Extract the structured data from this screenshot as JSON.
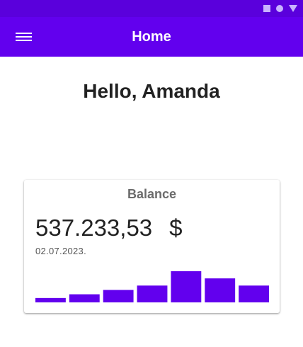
{
  "appbar": {
    "title": "Home",
    "background": "#6200ee",
    "statusbar_background": "#5a00dc"
  },
  "status_icons": [
    "square-icon",
    "circle-icon",
    "triangle-icon"
  ],
  "menu_icon": "hamburger-menu-icon",
  "greeting": "Hello, Amanda",
  "balance_card": {
    "title": "Balance",
    "amount": "537.233,53",
    "currency": "$",
    "date": "02.07.2023.",
    "bar_color": "#6200ee",
    "bars": [
      0.14,
      0.26,
      0.4,
      0.54,
      1.0,
      0.77,
      0.54
    ]
  }
}
